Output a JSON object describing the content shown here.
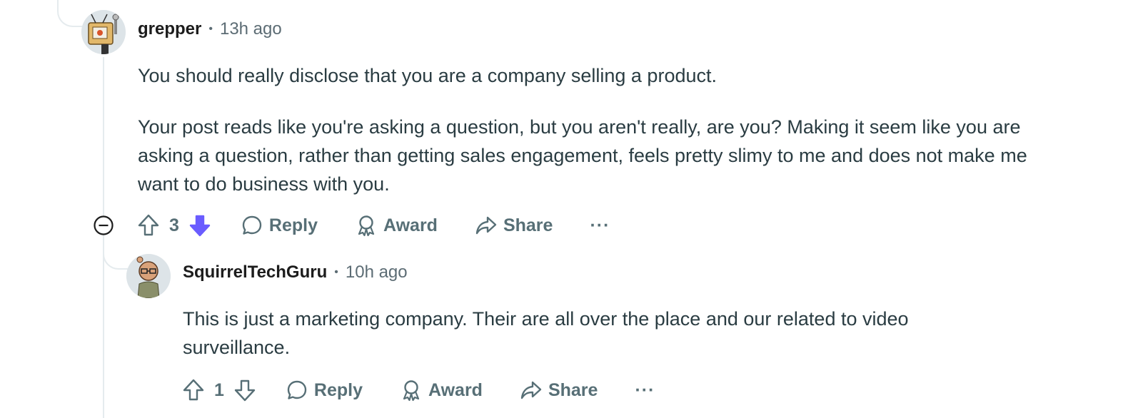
{
  "comments": [
    {
      "author": "grepper",
      "separator": "•",
      "time": "13h ago",
      "paragraphs": [
        "You should really disclose that you are a company selling a product.",
        "Your post reads like you're asking a question, but you aren't really, are you? Making it seem like you are asking a question, rather than getting sales engagement, feels pretty slimy to me and does not make me want to do business with you."
      ],
      "score": "3",
      "downvoted": true,
      "reply_label": "Reply",
      "award_label": "Award",
      "share_label": "Share",
      "more_label": "···"
    },
    {
      "author": "SquirrelTechGuru",
      "separator": "•",
      "time": "10h ago",
      "paragraphs": [
        "This is just a marketing company. Their are all over the place and our related to video surveillance."
      ],
      "score": "1",
      "downvoted": false,
      "reply_label": "Reply",
      "award_label": "Award",
      "share_label": "Share",
      "more_label": "···"
    }
  ],
  "colors": {
    "downvote_active": "#6a5cff",
    "meta_gray": "#5c6c74",
    "action_gray": "#576f76",
    "thread_line": "#e5ebee"
  }
}
